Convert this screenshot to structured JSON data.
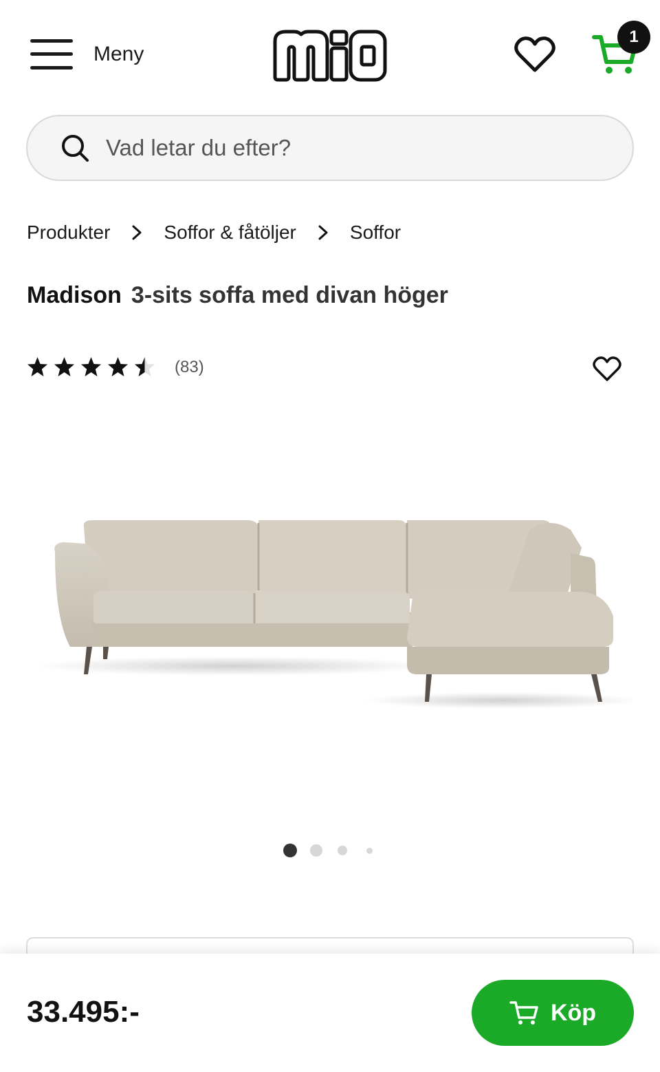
{
  "header": {
    "menu_label": "Meny",
    "logo_text": "mio",
    "cart_count": "1",
    "accent_color": "#1aaa28"
  },
  "search": {
    "placeholder": "Vad letar du efter?"
  },
  "breadcrumb": {
    "items": [
      "Produkter",
      "Soffor & fåtöljer",
      "Soffor"
    ]
  },
  "product": {
    "name": "Madison",
    "description": "3-sits soffa med divan höger",
    "rating": 4.5,
    "rating_max": 5,
    "review_count": "(83)",
    "image_alt": "beige corner sofa"
  },
  "carousel": {
    "total": 4,
    "active_index": 0
  },
  "footer": {
    "price": "33.495:-",
    "buy_label": "Köp"
  },
  "icons": {
    "menu": "hamburger-icon",
    "wishlist": "heart-icon",
    "cart": "cart-icon",
    "search": "search-icon",
    "breadcrumb_separator": "chevron-right-icon",
    "rating": "star-icon"
  }
}
